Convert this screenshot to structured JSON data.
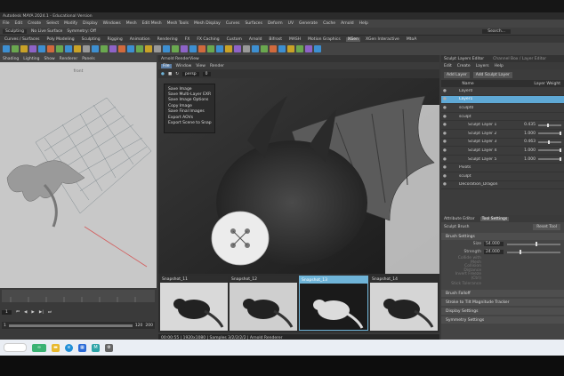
{
  "app": {
    "title": "Autodesk MAYA 2024.1 - Educational Version"
  },
  "menubar": [
    "File",
    "Edit",
    "Create",
    "Select",
    "Modify",
    "Display",
    "Windows",
    "Mesh",
    "Edit Mesh",
    "Mesh Tools",
    "Mesh Display",
    "Curves",
    "Surfaces",
    "Deform",
    "UV",
    "Generate",
    "Cache",
    "Arnold",
    "Help"
  ],
  "statusline": {
    "mode": "Sculpting",
    "no_live_surface": "No Live Surface",
    "symmetry": "Symmetry: Off",
    "search": "Search..."
  },
  "shelf": {
    "tabs": [
      "Curves / Surfaces",
      "Poly Modeling",
      "Sculpting",
      "Rigging",
      "Animation",
      "Rendering",
      "FX",
      "FX Caching",
      "Custom",
      "Arnold",
      "Bifrost",
      "MASH",
      "Motion Graphics",
      "XGen",
      "XGen Interactive",
      "MtoA"
    ],
    "active_tab": "XGen"
  },
  "left_panel": {
    "menu": [
      "Shading",
      "Lighting",
      "Show",
      "Renderer",
      "Panels"
    ],
    "camera_label": "front"
  },
  "timeline": {
    "current_frame": "1",
    "start": "1",
    "end": "120",
    "range_end": "200"
  },
  "viewport": {
    "title": "Arnold RenderView",
    "menu": [
      "File",
      "Window",
      "View",
      "Render"
    ],
    "active_menu": "File",
    "camera": "persp",
    "exposure": "0"
  },
  "file_menu": {
    "items": [
      "Save Image",
      "Save Multi-Layer EXR",
      "Save Image Options",
      "Copy Image",
      "Save Final Images",
      "Export AOVs",
      "Export Scene to Snap"
    ]
  },
  "snapshots": [
    {
      "label": "Snapshot_11"
    },
    {
      "label": "Snapshot_12"
    },
    {
      "label": "Snapshot_13",
      "selected": true
    },
    {
      "label": "Snapshot_14"
    }
  ],
  "render_status": "00:00:55 | 1920x1080 | Samples 3/2/2/2/2 | Arnold Renderer",
  "sculpt_editor": {
    "title": "Sculpt Layers Editor",
    "title_right": "Channel Box / Layer Editor",
    "menu": [
      "Edit",
      "Create",
      "Layers",
      "Help"
    ],
    "buttons": [
      "Add Layer",
      "Add Sculpt Layer"
    ],
    "col_name": "Name",
    "col_weight": "Layer Weight",
    "layers": [
      {
        "name": "Layer0",
        "weight": ""
      },
      {
        "name": "Layer1",
        "weight": "",
        "selected": true
      },
      {
        "name": "sculpt0",
        "weight": ""
      },
      {
        "name": "sculpt",
        "weight": ""
      },
      {
        "name": "Sculpt Layer 1",
        "weight": "0.435",
        "level": 0.435
      },
      {
        "name": "Sculpt Layer 2",
        "weight": "1.000",
        "level": 1.0
      },
      {
        "name": "Sculpt Layer 3",
        "weight": "0.463",
        "level": 0.463
      },
      {
        "name": "Sculpt Layer 4",
        "weight": "1.000",
        "level": 1.0
      },
      {
        "name": "Sculpt Layer 5",
        "weight": "1.000",
        "level": 1.0
      },
      {
        "name": "Pivots",
        "weight": ""
      },
      {
        "name": "sculpt",
        "weight": ""
      },
      {
        "name": "Decoration_Dragon",
        "weight": ""
      }
    ]
  },
  "attribute_editor": {
    "tabs": [
      "Attribute Editor",
      "Tool Settings"
    ],
    "active_tab": "Tool Settings",
    "tool_name": "Sculpt Brush",
    "reset_label": "Reset Tool",
    "sections": {
      "brush_settings": "Brush Settings",
      "brush_falloff": "Brush Falloff",
      "stroke": "Stroke to Tilt Magnitude Tracker",
      "display": "Display Settings",
      "symmetry": "Symmetry Settings"
    },
    "props": [
      {
        "label": "Size",
        "value": "54.000",
        "level": 0.54
      },
      {
        "label": "Strength",
        "value": "24.000",
        "level": 0.24
      },
      {
        "label": "Collide with Mesh",
        "value": "",
        "dim": true
      },
      {
        "label": "Collision Distance",
        "value": "",
        "dim": true
      },
      {
        "label": "Invert Freeze (Ctrl)",
        "value": "",
        "dim": true
      },
      {
        "label": "Stick Tolerance",
        "value": "",
        "dim": true
      }
    ]
  },
  "colors": {
    "accent": "#5fa9d6",
    "ui_dark": "#3a3a3a",
    "taskbar": "#eaeef4"
  }
}
